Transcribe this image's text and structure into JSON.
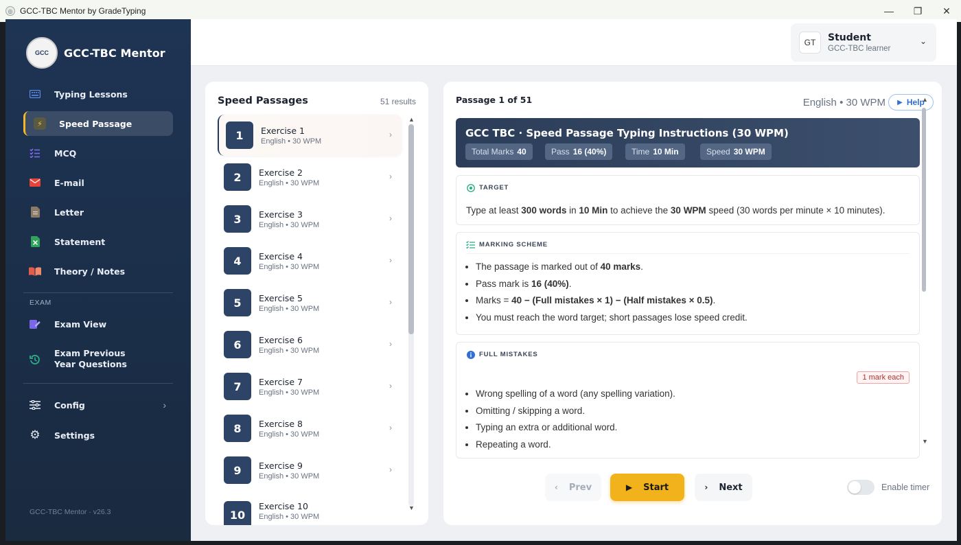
{
  "window": {
    "title": "GCC-TBC Mentor by GradeTyping",
    "minimize": "—",
    "maximize": "❐",
    "close": "✕"
  },
  "sidebar": {
    "brand": "GCC-TBC Mentor",
    "logo_text": "GCC",
    "items": [
      {
        "label": "Typing Lessons",
        "icon": "keyboard-icon"
      },
      {
        "label": "Speed Passage",
        "icon": "bolt-icon"
      },
      {
        "label": "MCQ",
        "icon": "checklist-icon"
      },
      {
        "label": "E-mail",
        "icon": "mail-icon"
      },
      {
        "label": "Letter",
        "icon": "document-icon"
      },
      {
        "label": "Statement",
        "icon": "spreadsheet-icon"
      },
      {
        "label": "Theory / Notes",
        "icon": "book-icon"
      }
    ],
    "exam_section": "EXAM",
    "exam_items": [
      {
        "label": "Exam View",
        "icon": "pen-icon"
      },
      {
        "label": "Exam Previous Year Questions",
        "icon": "history-icon"
      }
    ],
    "config_label": "Config",
    "settings_label": "Settings",
    "version": "GCC-TBC Mentor · v26.3"
  },
  "user": {
    "initials": "GT",
    "name": "Student",
    "role": "GCC-TBC learner"
  },
  "list": {
    "title": "Speed Passages",
    "count": "51 results",
    "exercises": [
      {
        "num": "1",
        "name": "Exercise 1",
        "sub": "English • 30 WPM"
      },
      {
        "num": "2",
        "name": "Exercise 2",
        "sub": "English • 30 WPM"
      },
      {
        "num": "3",
        "name": "Exercise 3",
        "sub": "English • 30 WPM"
      },
      {
        "num": "4",
        "name": "Exercise 4",
        "sub": "English • 30 WPM"
      },
      {
        "num": "5",
        "name": "Exercise 5",
        "sub": "English • 30 WPM"
      },
      {
        "num": "6",
        "name": "Exercise 6",
        "sub": "English • 30 WPM"
      },
      {
        "num": "7",
        "name": "Exercise 7",
        "sub": "English • 30 WPM"
      },
      {
        "num": "8",
        "name": "Exercise 8",
        "sub": "English • 30 WPM"
      },
      {
        "num": "9",
        "name": "Exercise 9",
        "sub": "English • 30 WPM"
      },
      {
        "num": "10",
        "name": "Exercise 10",
        "sub": "English • 30 WPM"
      }
    ]
  },
  "detail": {
    "passage_label": "Passage 1 of 51",
    "lang_meta": "English • 30 WPM",
    "help": "Help",
    "banner_title": "GCC TBC · Speed Passage Typing Instructions (30 WPM)",
    "pills": [
      {
        "label": "Total Marks",
        "value": "40"
      },
      {
        "label": "Pass",
        "value": "16 (40%)"
      },
      {
        "label": "Time",
        "value": "10 Min"
      },
      {
        "label": "Speed",
        "value": "30 WPM"
      }
    ],
    "target": {
      "head": "TARGET",
      "t1": "Type at least ",
      "b1": "300 words",
      "t2": " in ",
      "b2": "10 Min",
      "t3": " to achieve the ",
      "b3": "30 WPM",
      "t4": " speed (30 words per minute × 10 minutes)."
    },
    "marking": {
      "head": "MARKING SCHEME",
      "l1a": "The passage is marked out of ",
      "l1b": "40 marks",
      "l1c": ".",
      "l2a": "Pass mark is ",
      "l2b": "16 (40%)",
      "l2c": ".",
      "l3a": "Marks = ",
      "l3b": "40 − (Full mistakes × 1) − (Half mistakes × 0.5)",
      "l3c": ".",
      "l4": "You must reach the word target; short passages lose speed credit."
    },
    "full_mistakes": {
      "head": "FULL MISTAKES",
      "badge": "1 mark each",
      "items": [
        "Wrong spelling of a word (any spelling variation).",
        "Omitting / skipping a word.",
        "Typing an extra or additional word.",
        "Repeating a word."
      ]
    },
    "prev": "Prev",
    "start": "Start",
    "next": "Next",
    "timer_label": "Enable timer"
  }
}
